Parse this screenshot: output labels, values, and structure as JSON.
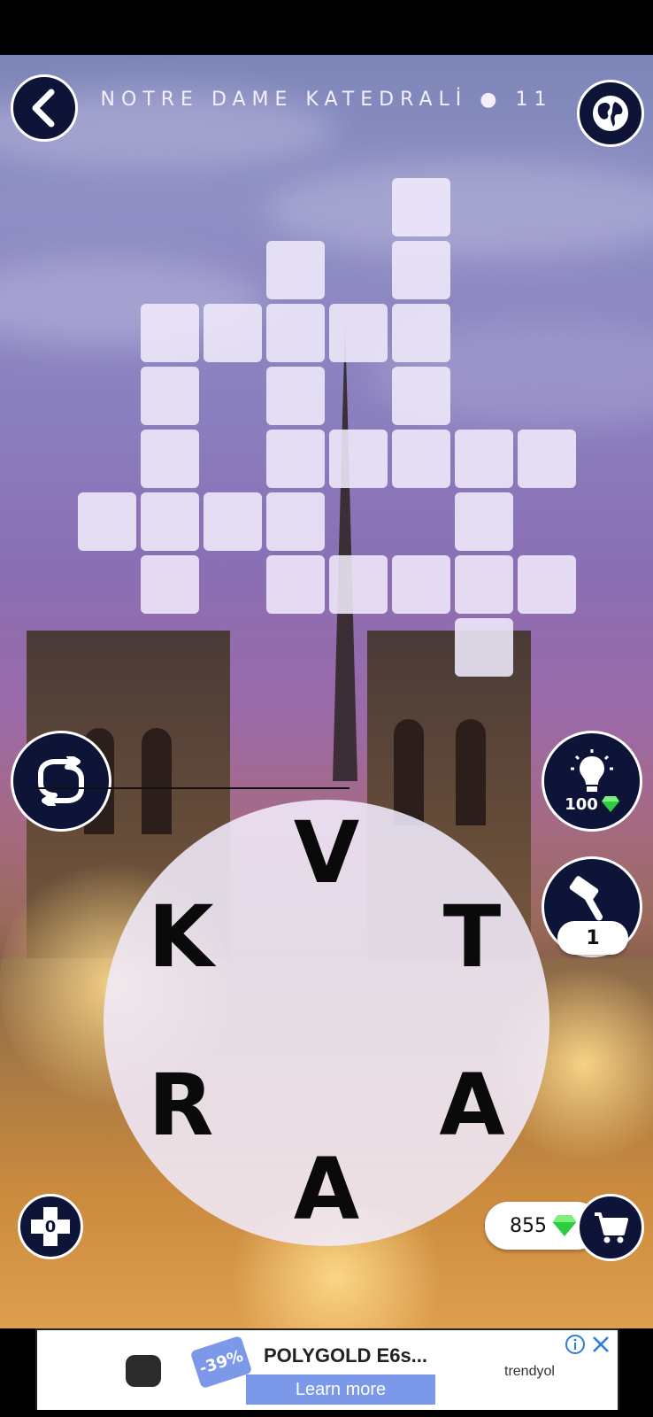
{
  "header": {
    "level_title": "NOTRE DAME KATEDRALİ ● 11",
    "back_icon": "chevron-left-icon",
    "globe_icon": "globe-icon"
  },
  "grid": {
    "cells": [
      [
        6,
        0
      ],
      [
        4,
        1
      ],
      [
        6,
        1
      ],
      [
        2,
        2
      ],
      [
        3,
        2
      ],
      [
        4,
        2
      ],
      [
        5,
        2
      ],
      [
        6,
        2
      ],
      [
        2,
        3
      ],
      [
        4,
        3
      ],
      [
        6,
        3
      ],
      [
        2,
        4
      ],
      [
        4,
        4
      ],
      [
        5,
        4
      ],
      [
        6,
        4
      ],
      [
        7,
        4
      ],
      [
        8,
        4
      ],
      [
        1,
        5
      ],
      [
        2,
        5
      ],
      [
        3,
        5
      ],
      [
        4,
        5
      ],
      [
        7,
        5
      ],
      [
        2,
        6
      ],
      [
        4,
        6
      ],
      [
        5,
        6
      ],
      [
        6,
        6
      ],
      [
        7,
        6
      ],
      [
        8,
        6
      ],
      [
        7,
        7
      ]
    ]
  },
  "wheel": {
    "letters": [
      "V",
      "T",
      "A",
      "A",
      "R",
      "K"
    ]
  },
  "hints": {
    "bulb_cost": "100",
    "hammer_count": "1",
    "bonus_count": "0"
  },
  "wallet": {
    "gems": "855"
  },
  "ad": {
    "discount": "-39%",
    "product": "POLYGOLD E6s...",
    "cta": "Learn more",
    "brand": "trendyol"
  },
  "colors": {
    "button_navy": "#0e1438",
    "tile_fill": "#f0eafa",
    "gem_green": "#2ecc40"
  }
}
